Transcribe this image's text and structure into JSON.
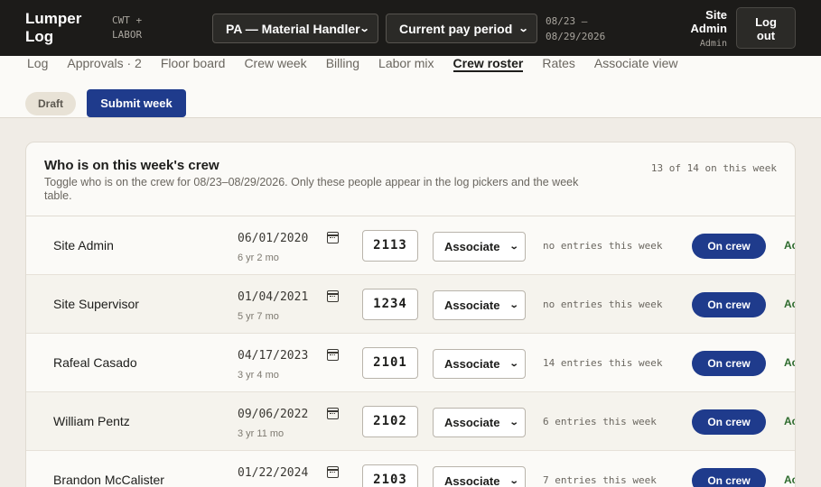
{
  "app": {
    "brand": "Lumper Log",
    "brand_sub": "CWT + LABOR"
  },
  "filters": {
    "role": "PA — Material Handler",
    "period": "Current pay period",
    "date_from": "08/23 –",
    "date_to": "08/29/2026"
  },
  "user": {
    "name_line1": "Site",
    "name_line2": "Admin",
    "role": "Admin",
    "logout": "Log out"
  },
  "tabs": [
    "Log",
    "Approvals · 2",
    "Floor board",
    "Crew week",
    "Billing",
    "Labor mix",
    "Crew roster",
    "Rates",
    "Associate view"
  ],
  "active_tab": "Crew roster",
  "actions": {
    "draft": "Draft",
    "submit": "Submit week"
  },
  "card": {
    "title": "Who is on this week's crew",
    "description": "Toggle who is on the crew for 08/23–08/29/2026. Only these people appear in the log pickers and the week table.",
    "count": "13 of 14 on this week"
  },
  "rows": [
    {
      "name": "Site Admin",
      "date": "06/01/2020",
      "tenure": "6 yr 2 mo",
      "number": "2113",
      "role": "Associate",
      "entries": "no entries this week",
      "crew": "On crew",
      "status": "Ac"
    },
    {
      "name": "Site Supervisor",
      "date": "01/04/2021",
      "tenure": "5 yr 7 mo",
      "number": "1234",
      "role": "Associate",
      "entries": "no entries this week",
      "crew": "On crew",
      "status": "Ac"
    },
    {
      "name": "Rafeal Casado",
      "date": "04/17/2023",
      "tenure": "3 yr 4 mo",
      "number": "2101",
      "role": "Associate",
      "entries": "14 entries this week",
      "crew": "On crew",
      "status": "Ac"
    },
    {
      "name": "William Pentz",
      "date": "09/06/2022",
      "tenure": "3 yr 11 mo",
      "number": "2102",
      "role": "Associate",
      "entries": "6 entries this week",
      "crew": "On crew",
      "status": "Ac"
    },
    {
      "name": "Brandon McCalister",
      "date": "01/22/2024",
      "tenure": "",
      "number": "2103",
      "role": "Associate",
      "entries": "7 entries this week",
      "crew": "On crew",
      "status": "Ac"
    }
  ],
  "icons": {
    "dropdown": "chevron-down-icon",
    "calendar": "calendar-icon"
  }
}
